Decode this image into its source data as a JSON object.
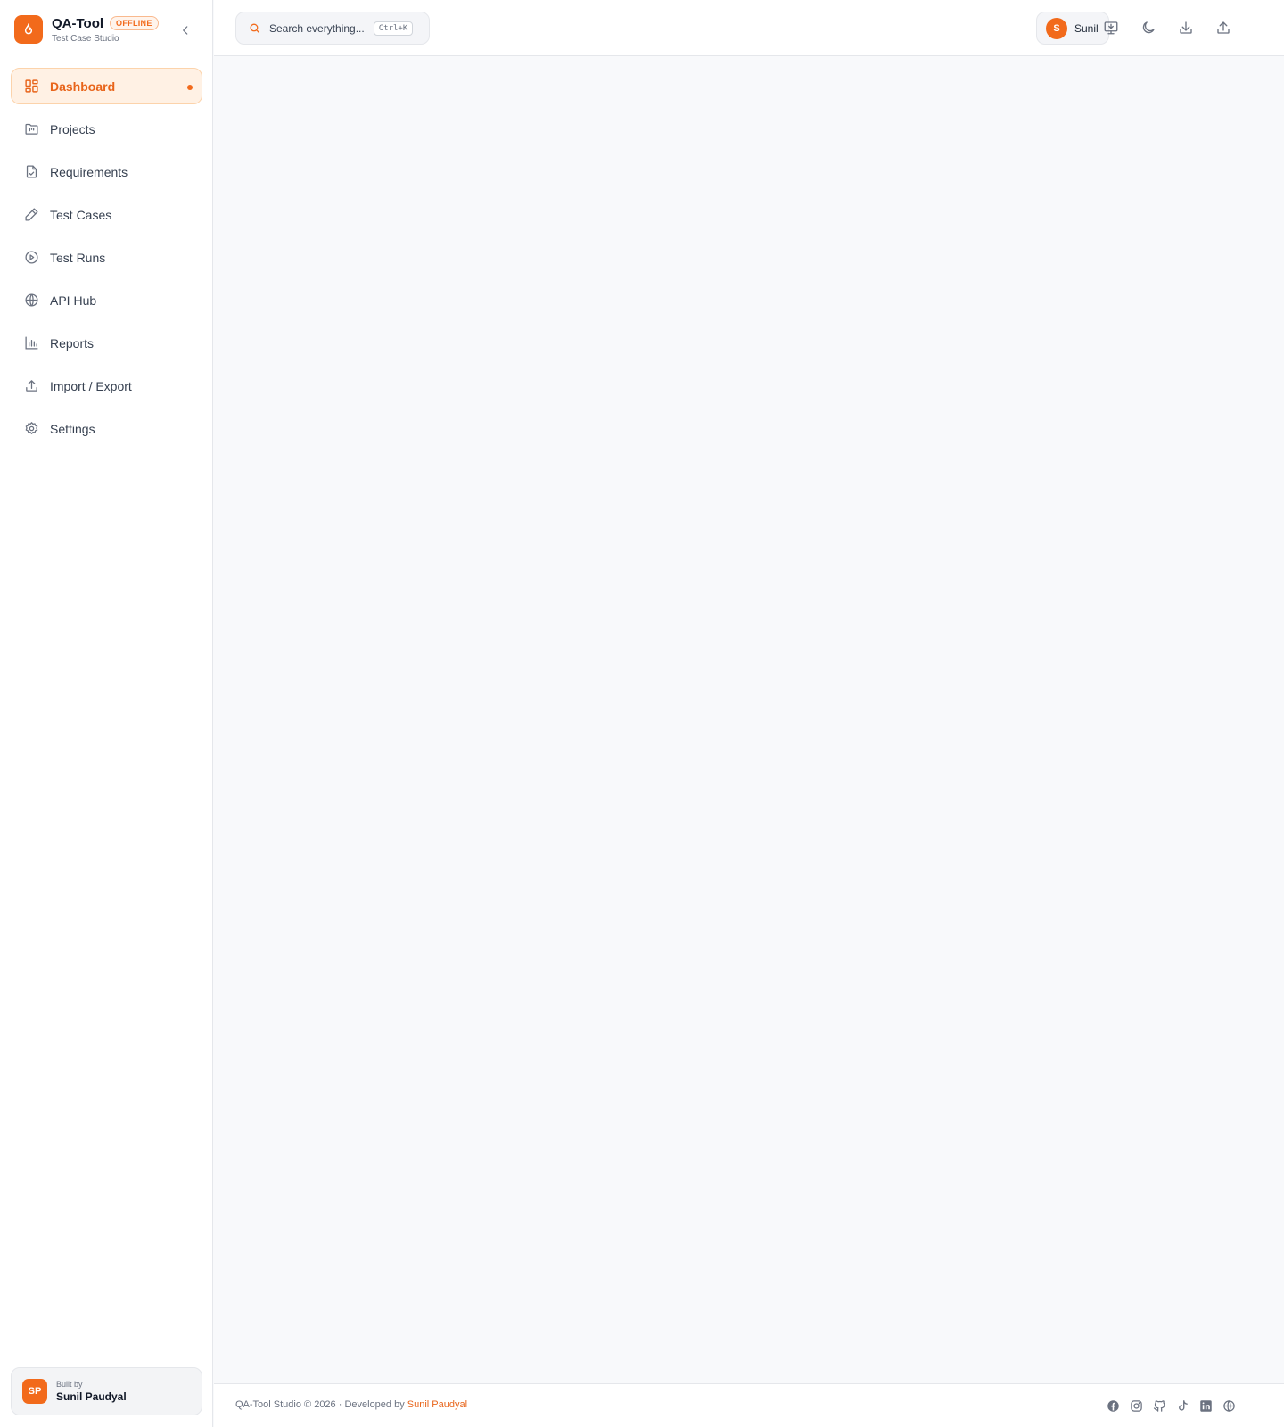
{
  "app": {
    "name": "QA-Tool",
    "status_badge": "OFFLINE",
    "subtitle": "Test Case Studio",
    "brand_color": "#f26a1b"
  },
  "sidebar": {
    "collapse_icon": "chevron-left-icon",
    "items": [
      {
        "label": "Dashboard",
        "icon": "layout-grid-icon",
        "active": true
      },
      {
        "label": "Projects",
        "icon": "folder-kanban-icon",
        "active": false
      },
      {
        "label": "Requirements",
        "icon": "file-check-icon",
        "active": false
      },
      {
        "label": "Test Cases",
        "icon": "pencil-icon",
        "active": false
      },
      {
        "label": "Test Runs",
        "icon": "play-circle-icon",
        "active": false
      },
      {
        "label": "API Hub",
        "icon": "globe-icon",
        "active": false
      },
      {
        "label": "Reports",
        "icon": "bar-chart-icon",
        "active": false
      },
      {
        "label": "Import / Export",
        "icon": "upload-icon",
        "active": false
      },
      {
        "label": "Settings",
        "icon": "gear-icon",
        "active": false
      }
    ],
    "built_by": {
      "avatar_initials": "SP",
      "caption": "Built by",
      "name": "Sunil Paudyal"
    }
  },
  "topbar": {
    "search": {
      "placeholder": "Search everything...",
      "shortcut": "Ctrl+K"
    },
    "user": {
      "initial": "S",
      "name": "Sunil"
    },
    "actions": [
      "install-app-icon",
      "moon-icon",
      "download-icon",
      "upload-icon"
    ]
  },
  "footer": {
    "text": "QA-Tool Studio © 2026 · Developed by ",
    "author": "Sunil Paudyal",
    "socials": [
      "facebook-icon",
      "instagram-icon",
      "github-icon",
      "tiktok-icon",
      "linkedin-icon",
      "website-globe-icon"
    ]
  }
}
